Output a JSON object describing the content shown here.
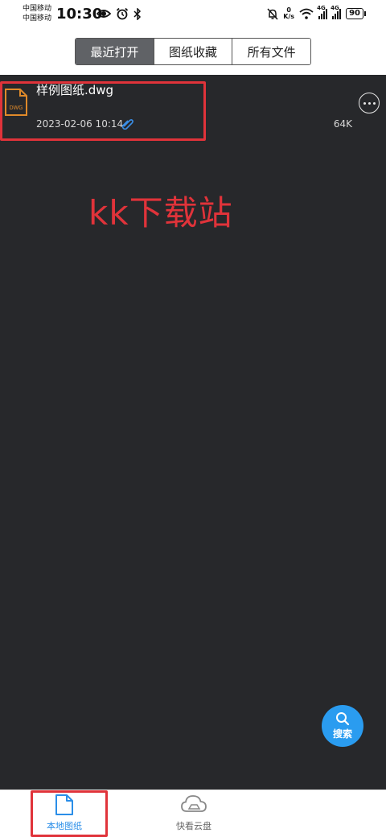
{
  "status_bar": {
    "carrier_1": "中国移动",
    "carrier_2": "中国移动",
    "time": "10:30",
    "net_speed_value": "0",
    "net_speed_unit": "K/s",
    "signal_1_label": "4G",
    "signal_2_label": "4G",
    "battery": "90"
  },
  "tabs": [
    {
      "label": "最近打开",
      "active": true
    },
    {
      "label": "图纸收藏",
      "active": false
    },
    {
      "label": "所有文件",
      "active": false
    }
  ],
  "files": [
    {
      "name": "样例图纸.dwg",
      "icon_label": "DWG",
      "date": "2023-02-06 10:14",
      "size": "64K"
    }
  ],
  "watermark": "kk下载站",
  "search_fab": {
    "label": "搜索"
  },
  "bottom_nav": [
    {
      "label": "本地图纸",
      "icon": "file-icon",
      "active": true
    },
    {
      "label": "快看云盘",
      "icon": "cloud-drive-icon",
      "active": false
    }
  ],
  "colors": {
    "accent": "#2a9cf0",
    "highlight": "#e0333a",
    "content_bg": "#27282b",
    "tab_active_bg": "#606266",
    "file_icon": "#e08a2a"
  }
}
